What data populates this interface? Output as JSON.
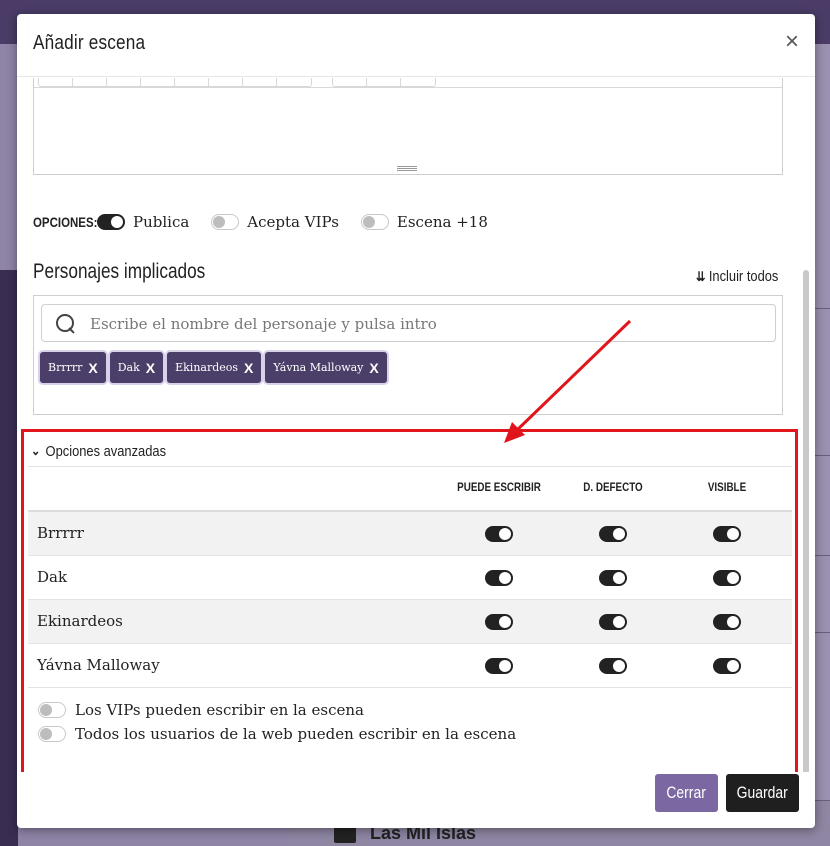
{
  "modal": {
    "title": "Añadir escena",
    "close_symbol": "×"
  },
  "options": {
    "label": "OPCIONES:",
    "items": [
      {
        "label": "Publica",
        "on": true
      },
      {
        "label": "Acepta VIPs",
        "on": false
      },
      {
        "label": "Escena +18",
        "on": false
      }
    ]
  },
  "characters": {
    "section_title": "Personajes implicados",
    "include_all": "Incluir todos",
    "search_placeholder": "Escribe el nombre del personaje y pulsa intro",
    "tags": [
      "Brrrrr",
      "Dak",
      "Ekinardeos",
      "Yávna Malloway"
    ],
    "tag_remove_symbol": "X"
  },
  "advanced": {
    "title": "Opciones avanzadas",
    "columns": [
      "PUEDE ESCRIBIR",
      "D. DEFECTO",
      "VISIBLE"
    ],
    "rows": [
      {
        "name": "Brrrrr",
        "puede_escribir": true,
        "defecto": true,
        "visible": true
      },
      {
        "name": "Dak",
        "puede_escribir": true,
        "defecto": true,
        "visible": true
      },
      {
        "name": "Ekinardeos",
        "puede_escribir": true,
        "defecto": true,
        "visible": true
      },
      {
        "name": "Yávna Malloway",
        "puede_escribir": true,
        "defecto": true,
        "visible": true
      }
    ],
    "extra_options": [
      {
        "label": "Los VIPs pueden escribir en la escena",
        "on": false
      },
      {
        "label": "Todos los usuarios de la web pueden escribir en la escena",
        "on": false
      }
    ]
  },
  "footer": {
    "close_label": "Cerrar",
    "save_label": "Guardar"
  },
  "background": {
    "bottom_title": "Las Mil Islas"
  },
  "colors": {
    "accent_purple": "#7b68a3",
    "tag_bg": "#4b3f69",
    "highlight_red": "#e0161c",
    "save_button": "#1f1f1f"
  }
}
